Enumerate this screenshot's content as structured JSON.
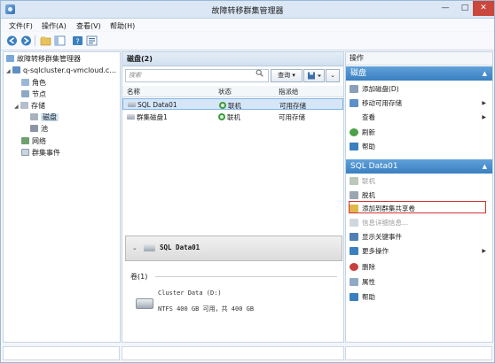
{
  "window": {
    "title": "故障转移群集管理器"
  },
  "window_controls": {
    "minimize": "—",
    "maximize": "□",
    "close": "✕"
  },
  "menu": [
    "文件(F)",
    "操作(A)",
    "查看(V)",
    "帮助(H)"
  ],
  "tree": {
    "root": "故障转移群集管理器",
    "cluster": "q-sqlcluster.q-vmcloud.c...",
    "items": [
      "角色",
      "节点",
      "存储",
      "磁盘",
      "池",
      "网络",
      "群集事件"
    ]
  },
  "center": {
    "header": "磁盘(2)",
    "search_placeholder": "搜索",
    "query_label": "查询",
    "query_arrow": "▾",
    "columns_toggle": "⌄",
    "columns": [
      "名称",
      "状态",
      "指派给"
    ],
    "rows": [
      {
        "name": "SQL Data01",
        "status": "联机",
        "assigned": "可用存储"
      },
      {
        "name": "群集磁盘1",
        "status": "联机",
        "assigned": "可用存储"
      }
    ],
    "detail": {
      "chevron": "⌄",
      "title": "SQL Data01",
      "volume_label": "卷(1)",
      "volume_name": "Cluster Data (D:)",
      "volume_info": "NTFS 400 GB 可用，共 400 GB"
    }
  },
  "actions": {
    "title": "操作",
    "section1": {
      "header": "磁盘",
      "items": [
        {
          "label": "添加磁盘(D)",
          "submenu": false,
          "disabled": false
        },
        {
          "label": "移动可用存储",
          "submenu": true,
          "disabled": false
        },
        {
          "label": "查看",
          "submenu": true,
          "disabled": false
        },
        {
          "label": "刷新",
          "submenu": false,
          "disabled": false
        },
        {
          "label": "帮助",
          "submenu": false,
          "disabled": false
        }
      ]
    },
    "section2": {
      "header": "SQL Data01",
      "items": [
        {
          "label": "联机",
          "submenu": false,
          "disabled": true
        },
        {
          "label": "脱机",
          "submenu": false,
          "disabled": false
        },
        {
          "label": "添加到群集共享卷",
          "submenu": false,
          "disabled": false
        },
        {
          "label": "信息详细信息...",
          "submenu": false,
          "disabled": true
        },
        {
          "label": "显示关键事件",
          "submenu": false,
          "disabled": false
        },
        {
          "label": "更多操作",
          "submenu": true,
          "disabled": false
        },
        {
          "label": "删除",
          "submenu": false,
          "disabled": false
        },
        {
          "label": "属性",
          "submenu": false,
          "disabled": false
        },
        {
          "label": "帮助",
          "submenu": false,
          "disabled": false
        }
      ]
    }
  },
  "icons": {
    "accent": "#3a7fc0",
    "highlight": "#d43232",
    "online": "#3f9b3f"
  }
}
